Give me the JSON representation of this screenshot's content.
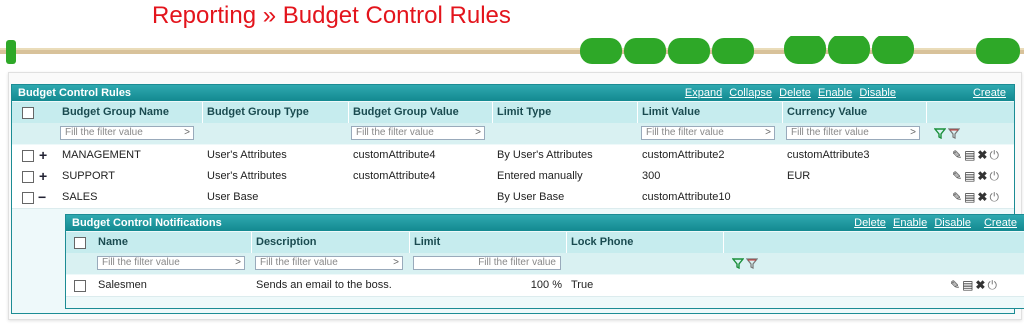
{
  "page": {
    "title": "Reporting » Budget Control Rules"
  },
  "colors": {
    "title_red": "#e3141c",
    "teal": "#138990",
    "bead_green": "#2ea828"
  },
  "main": {
    "title": "Budget Control Rules",
    "actions": [
      "Expand",
      "Collapse",
      "Delete",
      "Enable",
      "Disable"
    ],
    "create": "Create",
    "columns": [
      "Budget Group Name",
      "Budget Group Type",
      "Budget Group Value",
      "Limit Type",
      "Limit Value",
      "Currency Value"
    ],
    "filter_placeholder": "Fill the filter value",
    "rows": [
      {
        "expander": "+",
        "name": "MANAGEMENT",
        "type": "User's Attributes",
        "value": "customAttribute4",
        "limit_type": "By User's Attributes",
        "limit_value": "customAttribute2",
        "currency": "customAttribute3"
      },
      {
        "expander": "+",
        "name": "SUPPORT",
        "type": "User's Attributes",
        "value": "customAttribute4",
        "limit_type": "Entered manually",
        "limit_value": "300",
        "currency": "EUR"
      },
      {
        "expander": "−",
        "name": "SALES",
        "type": "User Base",
        "value": "",
        "limit_type": "By User Base",
        "limit_value": "customAttribute10",
        "currency": ""
      }
    ]
  },
  "notifications": {
    "title": "Budget Control Notifications",
    "actions": [
      "Delete",
      "Enable",
      "Disable"
    ],
    "create": "Create",
    "columns": [
      "Name",
      "Description",
      "Limit",
      "Lock Phone"
    ],
    "filter_placeholder": "Fill the filter value",
    "rows": [
      {
        "name": "Salesmen",
        "description": "Sends an email to the boss.",
        "limit": "100 %",
        "lock_phone": "True"
      }
    ]
  },
  "icons": {
    "edit": "pencil-icon",
    "copy": "copy-icon",
    "delete": "delete-x-icon",
    "power": "power-icon",
    "filter": "filter-icon",
    "clear_filter": "clear-filter-icon"
  }
}
